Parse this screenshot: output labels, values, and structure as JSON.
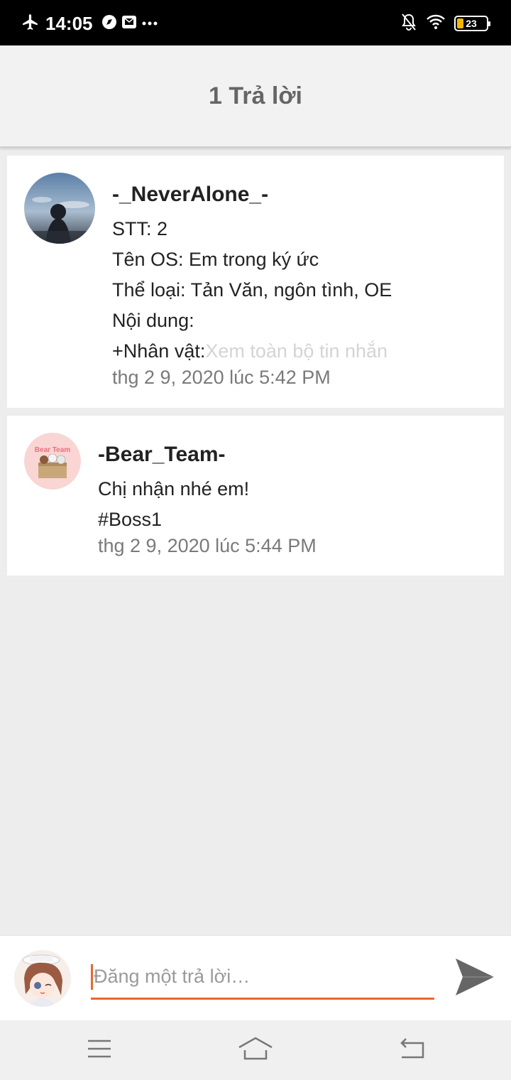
{
  "status_bar": {
    "time": "14:05",
    "battery_level": "23"
  },
  "header": {
    "title": "1 Trả lời"
  },
  "posts": [
    {
      "author": "-_NeverAlone_-",
      "lines": [
        "STT: 2",
        "Tên OS: Em trong ký ức",
        "Thể loại: Tản Văn, ngôn tình, OE",
        "Nội dung:",
        "+Nhân vật:"
      ],
      "see_more": "Xem toàn bộ tin nhắn",
      "timestamp": "thg 2 9, 2020 lúc 5:42 PM"
    },
    {
      "author": "-Bear_Team-",
      "lines": [
        "Chị nhận nhé em!",
        "#Boss1"
      ],
      "timestamp": "thg 2 9, 2020 lúc 5:44 PM",
      "avatar_text": "Bear Team"
    }
  ],
  "composer": {
    "placeholder": "Đăng một trả lời…"
  },
  "colors": {
    "accent": "#e8672e",
    "background": "#ededed",
    "header_text": "#666666"
  }
}
